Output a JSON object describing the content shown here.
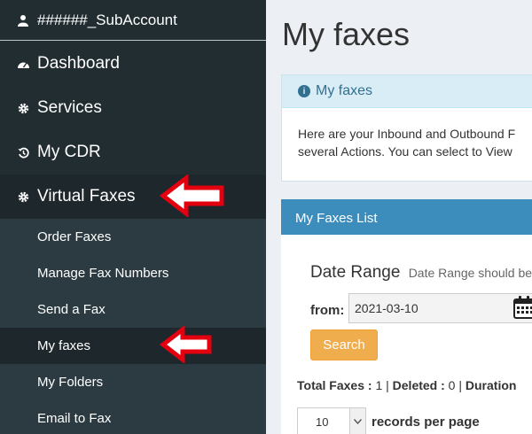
{
  "sidebar": {
    "account": "######_SubAccount",
    "items": [
      {
        "label": "Dashboard",
        "icon": "dashboard-icon"
      },
      {
        "label": "Services",
        "icon": "gear-icon"
      },
      {
        "label": "My CDR",
        "icon": "history-icon"
      },
      {
        "label": "Virtual Faxes",
        "icon": "gear-icon"
      }
    ],
    "subitems": [
      {
        "label": "Order Faxes"
      },
      {
        "label": "Manage Fax Numbers"
      },
      {
        "label": "Send a Fax"
      },
      {
        "label": "My faxes"
      },
      {
        "label": "My Folders"
      },
      {
        "label": "Email to Fax"
      }
    ]
  },
  "main": {
    "title": "My faxes",
    "info": {
      "title": "My faxes",
      "line1": "Here are your Inbound and Outbound F",
      "line2": "several Actions. You can select to View"
    },
    "list": {
      "title": "My Faxes List",
      "date_range_label": "Date Range",
      "date_range_hint": "Date Range should be",
      "from_label": "from:",
      "from_value": "2021-03-10",
      "search_label": "Search",
      "totals": {
        "total_label": "Total Faxes :",
        "total_value": "1",
        "deleted_label": "Deleted :",
        "deleted_value": "0",
        "duration_label": "Duration"
      },
      "records_value": "10",
      "records_label": "records per page"
    }
  },
  "colors": {
    "sidebar_bg": "#222d32",
    "accent": "#3c8dbc",
    "search_button": "#f0ad4e",
    "arrow": "#e3000f"
  }
}
